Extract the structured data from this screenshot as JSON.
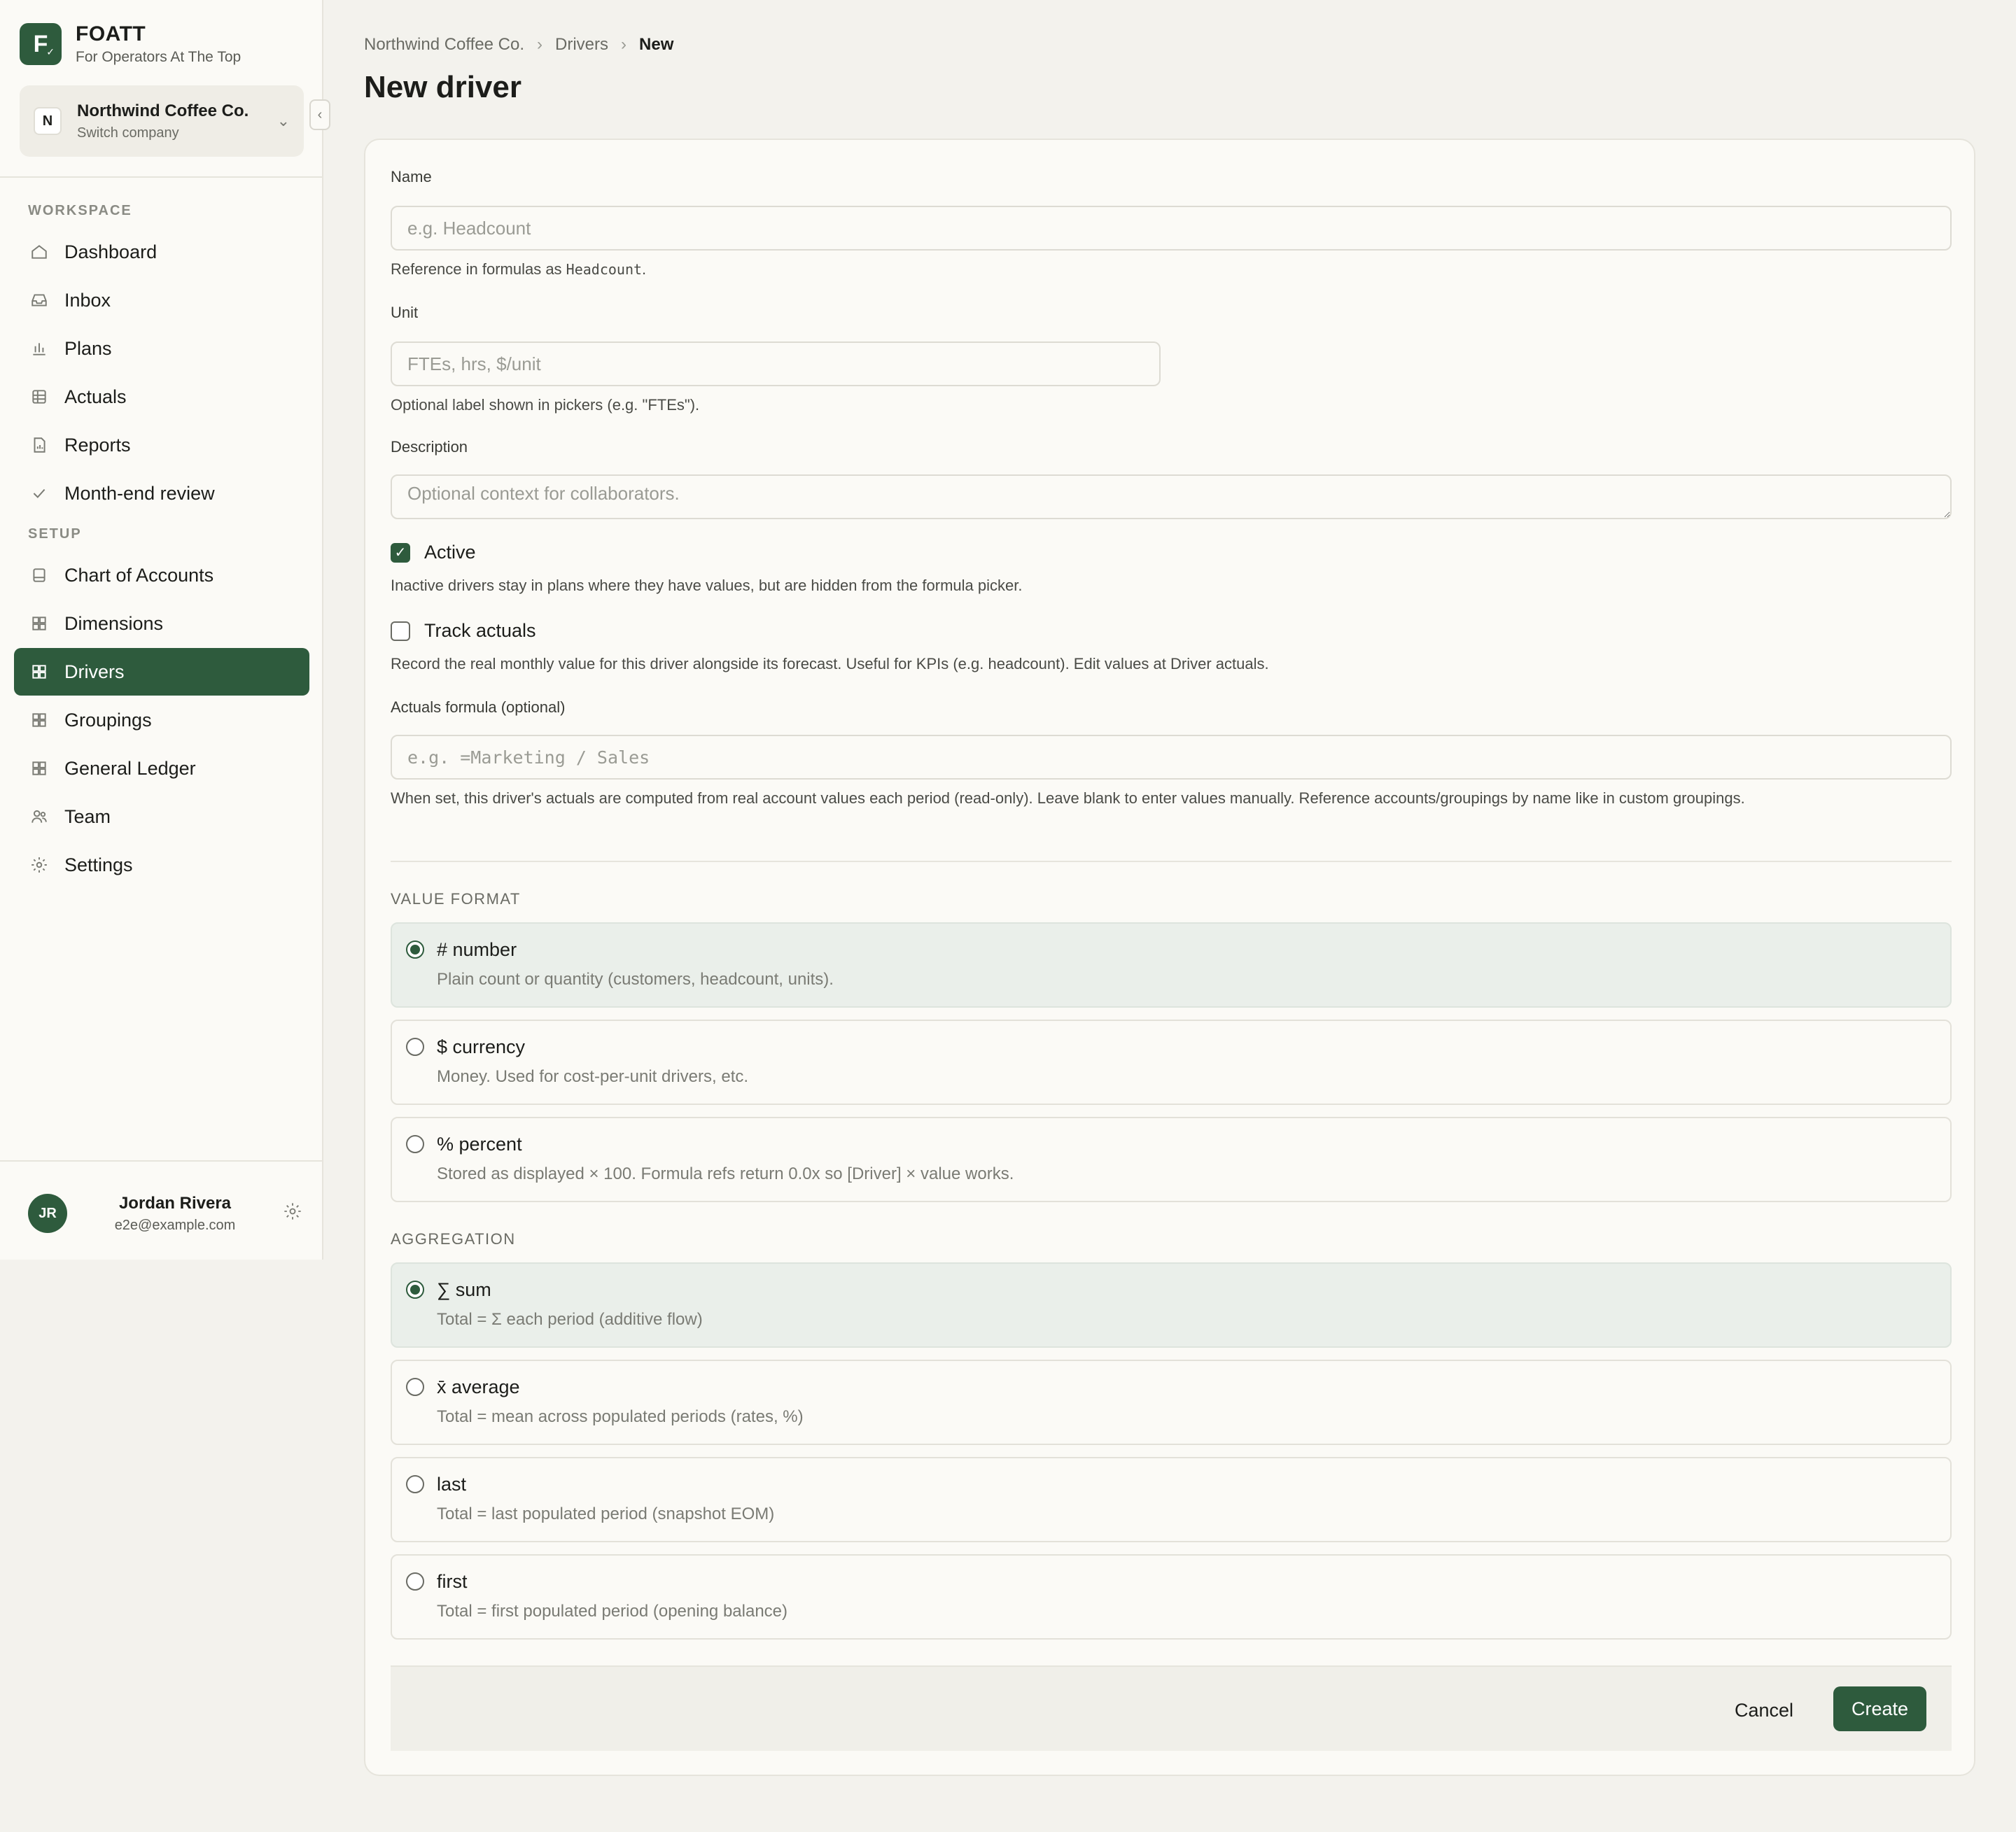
{
  "brand": {
    "name": "FOATT",
    "logo_letter": "F",
    "tagline": "For Operators At The Top"
  },
  "company": {
    "avatar": "N",
    "name": "Northwind Coffee Co.",
    "sub": "Switch company"
  },
  "sidebar": {
    "workspace_label": "WORKSPACE",
    "workspace_items": [
      {
        "label": "Dashboard",
        "icon": "home-icon"
      },
      {
        "label": "Inbox",
        "icon": "inbox-icon"
      },
      {
        "label": "Plans",
        "icon": "bar-chart-icon"
      },
      {
        "label": "Actuals",
        "icon": "table-icon"
      },
      {
        "label": "Reports",
        "icon": "report-icon"
      },
      {
        "label": "Month-end review",
        "icon": "check-icon"
      }
    ],
    "setup_label": "SETUP",
    "setup_items": [
      {
        "label": "Chart of Accounts",
        "icon": "book-icon"
      },
      {
        "label": "Dimensions",
        "icon": "grid-icon"
      },
      {
        "label": "Drivers",
        "icon": "grid-icon",
        "active": true
      },
      {
        "label": "Groupings",
        "icon": "grid-icon"
      },
      {
        "label": "General Ledger",
        "icon": "grid-icon"
      },
      {
        "label": "Team",
        "icon": "users-icon"
      },
      {
        "label": "Settings",
        "icon": "gear-icon"
      }
    ]
  },
  "user": {
    "initials": "JR",
    "name": "Jordan Rivera",
    "email": "e2e@example.com"
  },
  "breadcrumb": {
    "company": "Northwind Coffee Co.",
    "section": "Drivers",
    "current": "New"
  },
  "page_title": "New driver",
  "form": {
    "name": {
      "label": "Name",
      "placeholder": "e.g. Headcount",
      "hint_prefix": "Reference in formulas as ",
      "hint_code": "Headcount",
      "hint_suffix": "."
    },
    "unit": {
      "label": "Unit",
      "placeholder": "FTEs, hrs, $/unit",
      "hint": "Optional label shown in pickers (e.g. \"FTEs\")."
    },
    "description": {
      "label": "Description",
      "placeholder": "Optional context for collaborators."
    },
    "active": {
      "label": "Active",
      "checked": true,
      "hint": "Inactive drivers stay in plans where they have values, but are hidden from the formula picker."
    },
    "track_actuals": {
      "label": "Track actuals",
      "checked": false,
      "hint": "Record the real monthly value for this driver alongside its forecast. Useful for KPIs (e.g. headcount). Edit values at Driver actuals."
    },
    "actuals_formula": {
      "label": "Actuals formula (optional)",
      "placeholder": "e.g. =Marketing / Sales",
      "hint": "When set, this driver's actuals are computed from real account values each period (read-only). Leave blank to enter values manually. Reference accounts/groupings by name like in custom groupings."
    },
    "value_format": {
      "label": "VALUE FORMAT",
      "options": [
        {
          "title": "# number",
          "desc": "Plain count or quantity (customers, headcount, units).",
          "selected": true
        },
        {
          "title": "$ currency",
          "desc": "Money. Used for cost-per-unit drivers, etc.",
          "selected": false
        },
        {
          "title": "% percent",
          "desc": "Stored as displayed × 100. Formula refs return 0.0x so [Driver] × value works.",
          "selected": false
        }
      ]
    },
    "aggregation": {
      "label": "AGGREGATION",
      "options": [
        {
          "title": "∑ sum",
          "desc": "Total = Σ each period (additive flow)",
          "selected": true
        },
        {
          "title": "x̄ average",
          "desc": "Total = mean across populated periods (rates, %)",
          "selected": false
        },
        {
          "title": "last",
          "desc": "Total = last populated period (snapshot EOM)",
          "selected": false
        },
        {
          "title": "first",
          "desc": "Total = first populated period (opening balance)",
          "selected": false
        }
      ]
    },
    "cancel_label": "Cancel",
    "create_label": "Create"
  },
  "colors": {
    "accent": "#2e5b3d",
    "selected_option_bg": "#eaefea",
    "page_bg": "#f3f2ed",
    "card_bg": "#fbfaf6"
  }
}
